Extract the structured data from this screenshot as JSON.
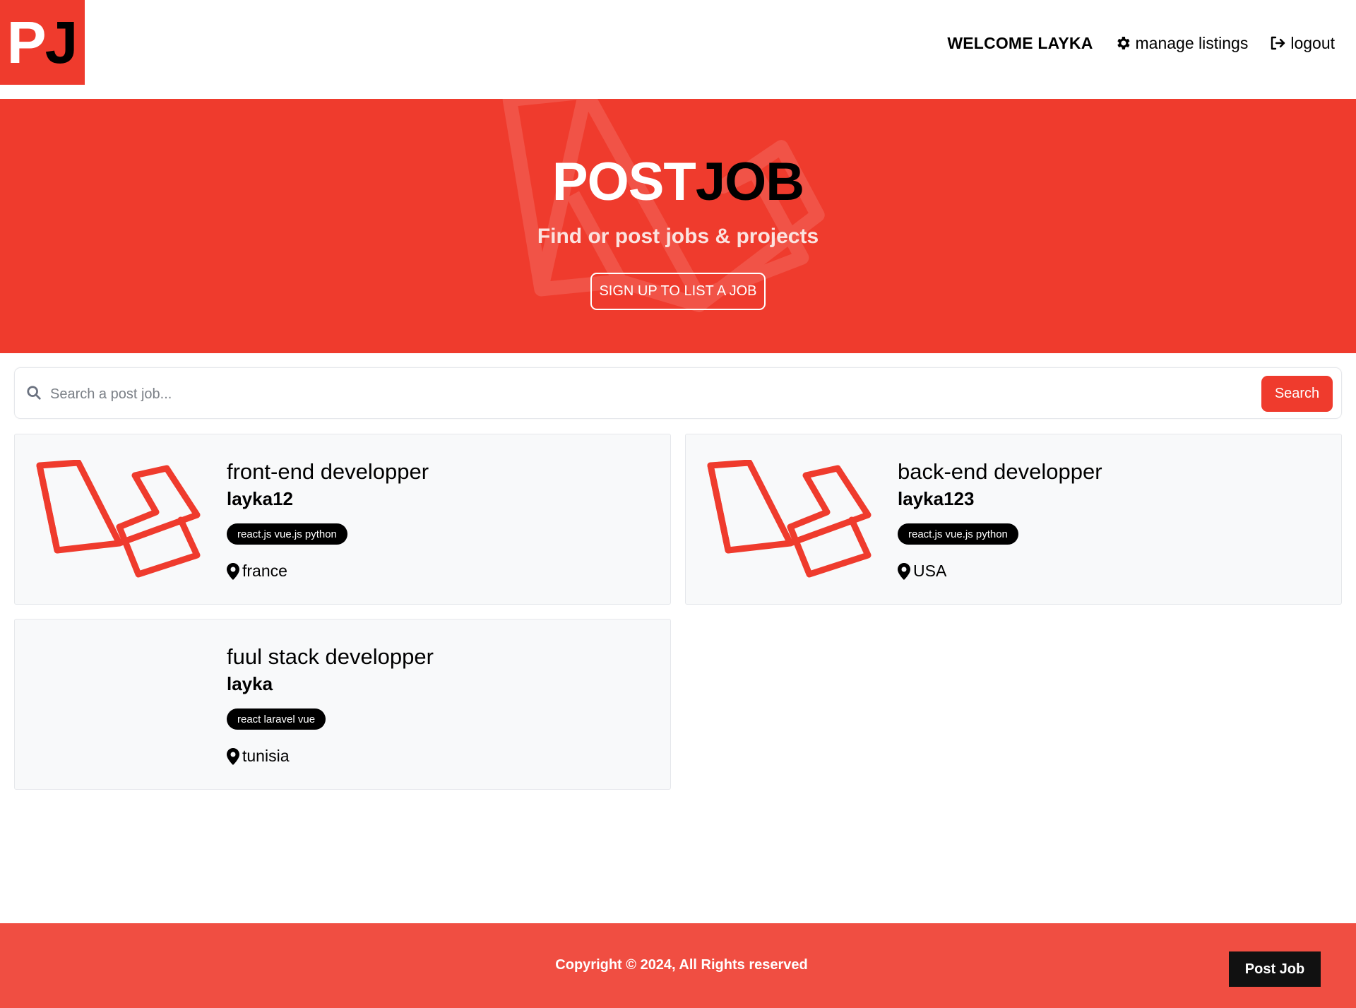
{
  "header": {
    "logo_p": "P",
    "logo_j": "J",
    "welcome": "WELCOME LAYKA",
    "manage_listings": "manage listings",
    "logout": "logout"
  },
  "hero": {
    "title_part1": "POST",
    "title_part2": "JOB",
    "subtitle": "Find or post jobs & projects",
    "cta": "SIGN UP TO LIST A JOB"
  },
  "search": {
    "placeholder": "Search a post job...",
    "button": "Search"
  },
  "listings": [
    {
      "title": "front-end developper",
      "company": "layka12",
      "tags": "react.js vue.js python",
      "location": "france"
    },
    {
      "title": "back-end developper",
      "company": "layka123",
      "tags": "react.js vue.js python",
      "location": "USA"
    },
    {
      "title": "fuul stack developper",
      "company": "layka",
      "tags": "react laravel vue",
      "location": "tunisia"
    }
  ],
  "footer": {
    "copyright": "Copyright © 2024, All Rights reserved",
    "post_job": "Post Job"
  },
  "colors": {
    "brand_red": "#ef3b2d",
    "footer_red": "#f04e42",
    "dark": "#111111"
  },
  "icons": [
    "gear-icon",
    "logout-icon",
    "search-icon",
    "map-pin-icon",
    "laravel-logo"
  ]
}
